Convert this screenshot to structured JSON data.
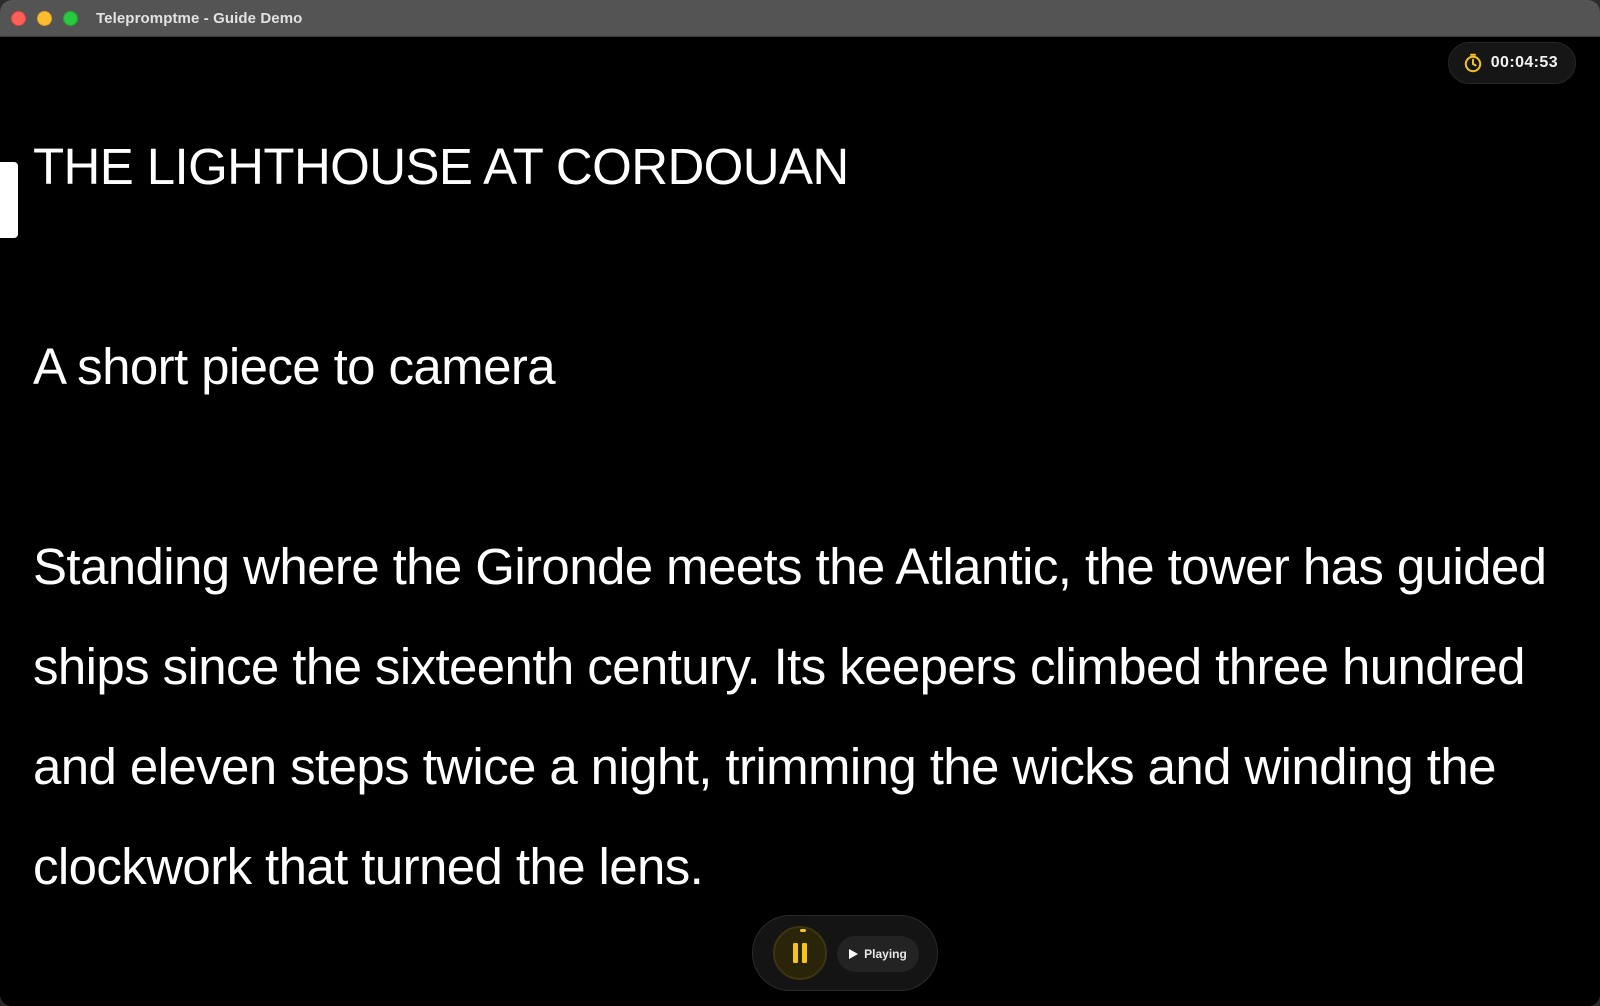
{
  "window": {
    "title": "Telepromptme - Guide Demo"
  },
  "timer": {
    "icon": "timer-icon",
    "value": "00:04:53",
    "color": "#f5c518"
  },
  "script": {
    "title": "THE LIGHTHOUSE AT CORDOUAN",
    "subtitle": "A short piece to camera",
    "body_lines": [
      "Standing where the Gironde meets the Atlantic, the tower has guided",
      "ships since the sixteenth century. Its keepers climbed three hundred",
      "and eleven steps twice a night, trimming the wicks and winding the",
      "clockwork that turned the lens."
    ]
  },
  "controls": {
    "pause_icon": "pause-icon",
    "status_icon": "play-icon",
    "status_label": "Playing",
    "accent_color": "#f5c518"
  }
}
